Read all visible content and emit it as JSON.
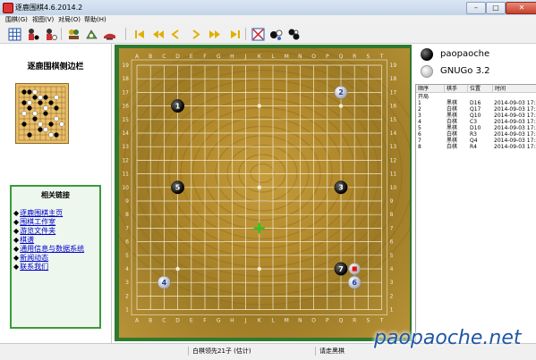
{
  "window": {
    "title": "逐鹿围棋4.6.2014.2"
  },
  "menu": [
    "围棋(G)",
    "视图(V)",
    "对局(O)",
    "帮助(H)"
  ],
  "sidebar": {
    "title": "逐鹿围棋侧边栏",
    "links_title": "相关链接",
    "links": [
      "逐鹿围棋主页",
      "围棋工作室",
      "游览文件夹",
      "棋谱",
      "通用信息与数据系统",
      "新闻动态",
      "联系我们"
    ]
  },
  "board": {
    "size": 19,
    "col_labels": [
      "A",
      "B",
      "C",
      "D",
      "E",
      "F",
      "G",
      "H",
      "J",
      "K",
      "L",
      "M",
      "N",
      "O",
      "P",
      "Q",
      "R",
      "S",
      "T"
    ],
    "row_labels": [
      "19",
      "18",
      "17",
      "16",
      "15",
      "14",
      "13",
      "12",
      "11",
      "10",
      "9",
      "8",
      "7",
      "6",
      "5",
      "4",
      "3",
      "2",
      "1"
    ],
    "stones": [
      {
        "move": "1",
        "color": "black",
        "coord": "D16"
      },
      {
        "move": "2",
        "color": "white",
        "coord": "Q17"
      },
      {
        "move": "3",
        "color": "black",
        "coord": "Q10"
      },
      {
        "move": "4",
        "color": "white",
        "coord": "C3"
      },
      {
        "move": "5",
        "color": "black",
        "coord": "D10"
      },
      {
        "move": "6",
        "color": "white",
        "coord": "R3"
      },
      {
        "move": "7",
        "color": "black",
        "coord": "Q4"
      }
    ],
    "hoshi": [
      "D4",
      "K4",
      "Q4",
      "D10",
      "K10",
      "Q10",
      "D16",
      "K16",
      "Q16"
    ],
    "last_move": "R4",
    "cursor": "K7"
  },
  "players": [
    {
      "name": "paopaoche",
      "color": "black"
    },
    {
      "name": "GNUGo 3.2",
      "color": "white"
    }
  ],
  "move_table": {
    "headers": [
      "顺序",
      "棋手",
      "位置",
      "时间"
    ],
    "rows": [
      {
        "seq": "开局",
        "player": "",
        "pos": "",
        "time": ""
      },
      {
        "seq": "1",
        "player": "黑棋",
        "pos": "D16",
        "time": "2014-09-03 17:2"
      },
      {
        "seq": "2",
        "player": "白棋",
        "pos": "Q17",
        "time": "2014-09-03 17:2"
      },
      {
        "seq": "3",
        "player": "黑棋",
        "pos": "Q10",
        "time": "2014-09-03 17:2"
      },
      {
        "seq": "4",
        "player": "白棋",
        "pos": "C3",
        "time": "2014-09-03 17:2"
      },
      {
        "seq": "5",
        "player": "黑棋",
        "pos": "D10",
        "time": "2014-09-03 17:2"
      },
      {
        "seq": "6",
        "player": "白棋",
        "pos": "R3",
        "time": "2014-09-03 17:2"
      },
      {
        "seq": "7",
        "player": "黑棋",
        "pos": "Q4",
        "time": "2014-09-03 17:2"
      },
      {
        "seq": "8",
        "player": "白棋",
        "pos": "R4",
        "time": "2014-09-03 17:2"
      }
    ]
  },
  "status": {
    "left": "白棋领先21子 (估计)",
    "right": "请走黑棋"
  },
  "watermark": "paopaoche.net",
  "colors": {
    "board_border": "#2e7a2e",
    "link": "#0000cc",
    "cursor": "#22cc22",
    "last_move": "#dd1111"
  }
}
